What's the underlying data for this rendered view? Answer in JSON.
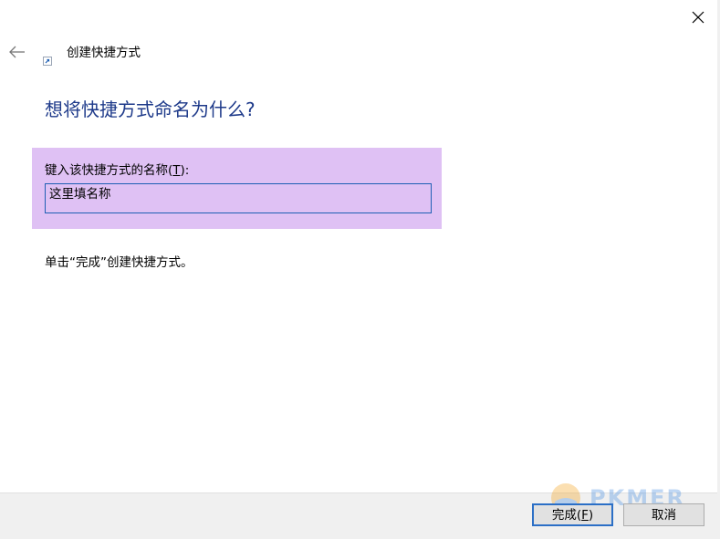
{
  "window": {
    "title": "创建快捷方式",
    "close_icon": "close-icon",
    "back_icon": "back-arrow-icon",
    "shortcut_icon": "shortcut-icon"
  },
  "page": {
    "heading": "想将快捷方式命名为什么?",
    "name_label_prefix": "键入该快捷方式的名称(",
    "name_label_accel": "T",
    "name_label_suffix": "):",
    "name_value": "这里填名称",
    "instruction": "单击“完成”创建快捷方式。"
  },
  "footer": {
    "finish_prefix": "完成(",
    "finish_accel": "F",
    "finish_suffix": ")",
    "cancel_label": "取消"
  },
  "watermark": {
    "text": "PKMER"
  },
  "colors": {
    "heading": "#1e3a8a",
    "highlight": "#dfc1f4",
    "input_border": "#1e5fb4",
    "default_button_border": "#2b6fc6",
    "footer_bg": "#f0f0f0"
  }
}
